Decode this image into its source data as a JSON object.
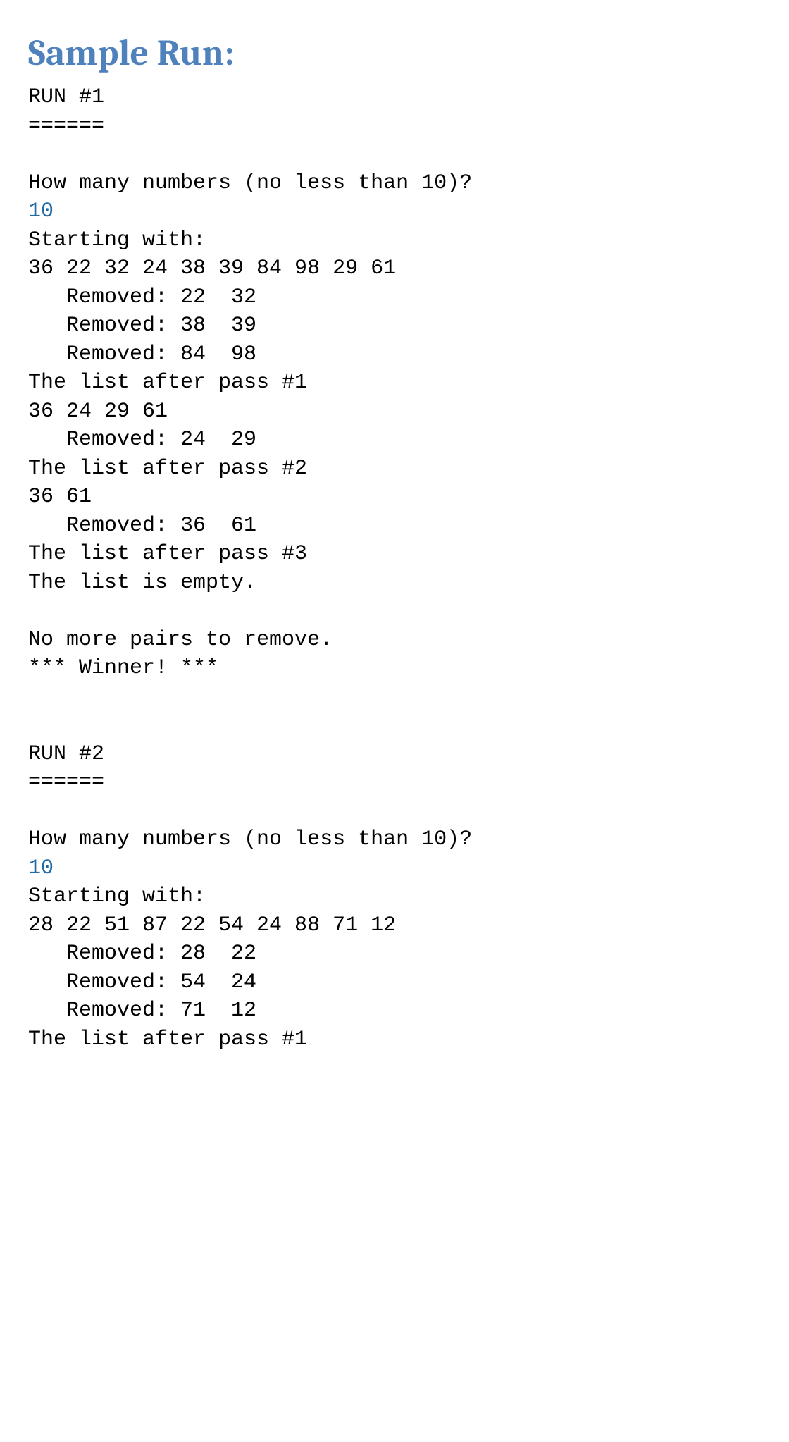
{
  "heading": "Sample Run:",
  "run1": {
    "title": "RUN #1",
    "divider": "======",
    "prompt": "How many numbers (no less than 10)?",
    "input": "10",
    "starting_label": "Starting with:",
    "starting_list": "36 22 32 24 38 39 84 98 29 61",
    "removed1": "   Removed: 22  32",
    "removed2": "   Removed: 38  39",
    "removed3": "   Removed: 84  98",
    "pass1_label": "The list after pass #1",
    "pass1_list": "36 24 29 61",
    "removed4": "   Removed: 24  29",
    "pass2_label": "The list after pass #2",
    "pass2_list": "36 61",
    "removed5": "   Removed: 36  61",
    "pass3_label": "The list after pass #3",
    "empty_label": "The list is empty.",
    "no_more": "No more pairs to remove.",
    "winner": "*** Winner! ***"
  },
  "run2": {
    "title": "RUN #2",
    "divider": "======",
    "prompt": "How many numbers (no less than 10)?",
    "input": "10",
    "starting_label": "Starting with:",
    "starting_list": "28 22 51 87 22 54 24 88 71 12",
    "removed1": "   Removed: 28  22",
    "removed2": "   Removed: 54  24",
    "removed3": "   Removed: 71  12",
    "pass1_label": "The list after pass #1"
  }
}
